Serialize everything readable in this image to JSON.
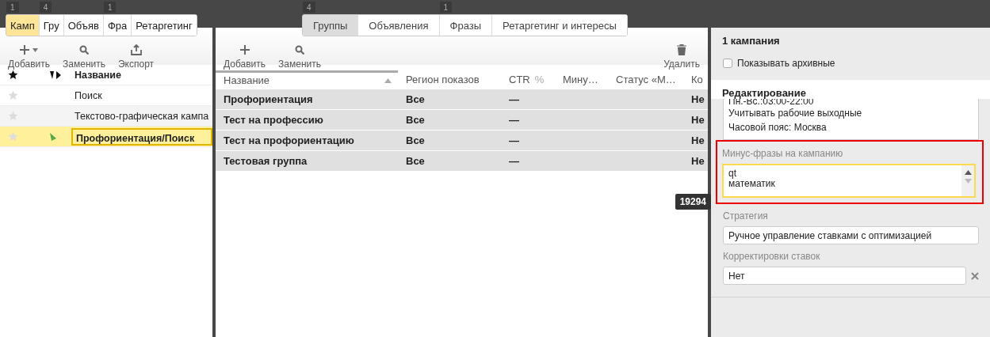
{
  "left_panel": {
    "tabs": [
      {
        "label": "Камп",
        "badge": "1",
        "selected": true
      },
      {
        "label": "Гру",
        "badge": "4",
        "selected": false
      },
      {
        "label": "Объяв",
        "selected": false
      },
      {
        "label": "Фра",
        "badge": "1",
        "selected": false
      },
      {
        "label": "Ретаргетинг",
        "selected": false
      }
    ],
    "toolbar": [
      {
        "kind": "add",
        "label": "Добавить",
        "has_menu": true
      },
      {
        "kind": "replace",
        "label": "Заменить",
        "has_menu": false
      },
      {
        "kind": "export",
        "label": "Экспорт",
        "has_menu": false
      }
    ],
    "table": {
      "columns": [
        {
          "kind": "star"
        },
        {
          "kind": "flag"
        },
        {
          "kind": "text",
          "label": "Название"
        }
      ],
      "rows": [
        {
          "name": "Поиск",
          "starred": false,
          "flagged": false,
          "selected": false
        },
        {
          "name": "Текстово-графическая кампа",
          "starred": false,
          "flagged": false,
          "selected": false
        },
        {
          "name": "Профориентация/Поиск",
          "starred": false,
          "flagged": true,
          "selected": true
        }
      ]
    }
  },
  "middle_panel": {
    "tabs": [
      {
        "label": "Группы",
        "badge": "4",
        "selected": true
      },
      {
        "label": "Объявления",
        "selected": false
      },
      {
        "label": "Фразы",
        "badge": "1",
        "selected": false
      },
      {
        "label": "Ретаргетинг и интересы",
        "selected": false
      }
    ],
    "toolbar": [
      {
        "kind": "add",
        "label": "Добавить",
        "has_menu": false
      },
      {
        "kind": "replace",
        "label": "Заменить",
        "has_menu": false
      },
      {
        "kind": "delete",
        "label": "Удалить",
        "has_menu": false
      }
    ],
    "table": {
      "columns": [
        {
          "label": "Название",
          "sort_ascending": true
        },
        {
          "label": "Регион показов"
        },
        {
          "label": "CTR",
          "unit": "%"
        },
        {
          "label": "Мину…"
        },
        {
          "label": "Статус «М…"
        },
        {
          "label": "Ко"
        }
      ],
      "rows": [
        [
          "Профориентация",
          "Все",
          "—",
          "",
          "",
          "Не"
        ],
        [
          "Тест на профессию",
          "Все",
          "—",
          "",
          "",
          "Не"
        ],
        [
          "Тест на профориентацию",
          "Все",
          "—",
          "",
          "",
          "Не"
        ],
        [
          "Тестовая группа",
          "Все",
          "—",
          "",
          "",
          "Не"
        ]
      ]
    },
    "tooltip": "19294"
  },
  "right_panel": {
    "title": "1 кампания",
    "show_archived": {
      "label": "Показывать архивные",
      "checked": false
    },
    "section_title": "Редактирование",
    "schedule_lines": [
      "Пн.-Вс.:03:00-22:00",
      "Учитывать рабочие выходные",
      "Часовой пояс: Москва"
    ],
    "minus_phrases": {
      "label": "Минус-фразы на кампанию",
      "lines": [
        "qt",
        "математик"
      ],
      "highlighted": true
    },
    "strategy": {
      "label": "Стратегия",
      "value": "Ручное управление ставками с оптимизацией"
    },
    "bid_adjustments": {
      "label": "Корректировки ставок",
      "value": "Нет"
    }
  }
}
